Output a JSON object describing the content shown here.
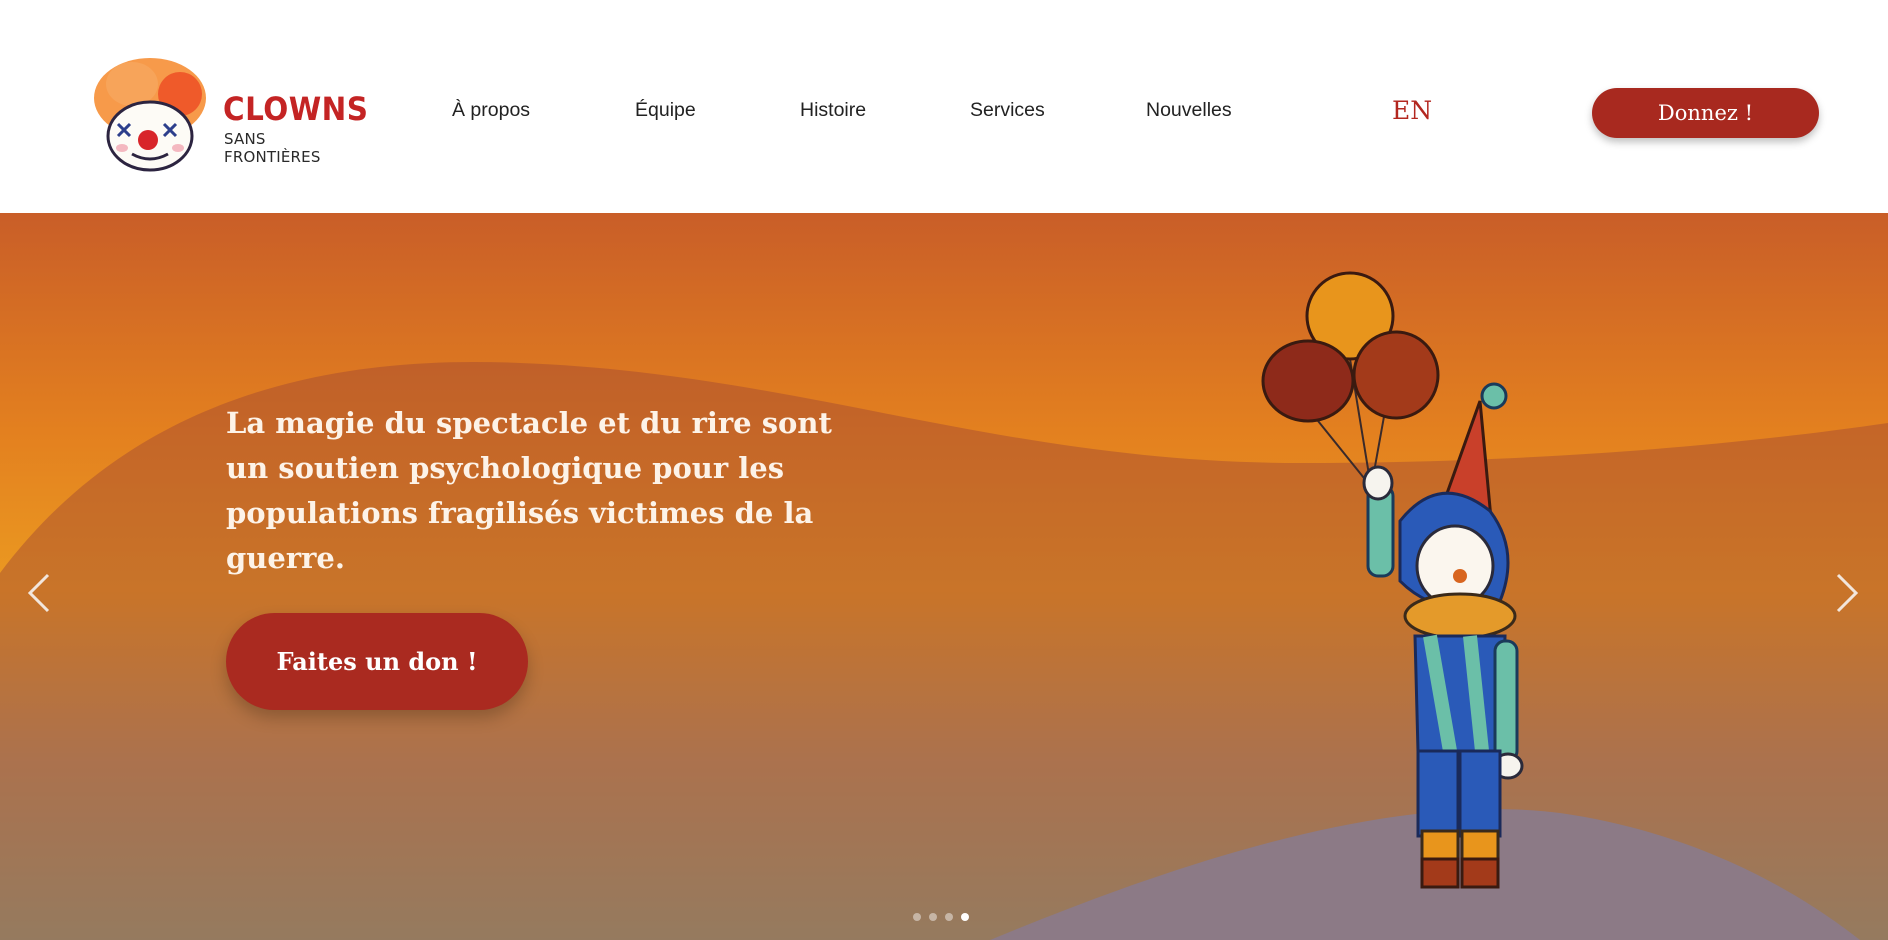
{
  "header": {
    "logo": {
      "title": "CLOWNS",
      "subtitle": "SANS FRONTIÈRES"
    },
    "nav": [
      {
        "label": "À propos"
      },
      {
        "label": "Équipe"
      },
      {
        "label": "Histoire"
      },
      {
        "label": "Services"
      },
      {
        "label": "Nouvelles"
      }
    ],
    "lang_label": "EN",
    "donate_label": "Donnez !"
  },
  "hero": {
    "headline": "La magie du spectacle et du rire sont un soutien psychologique pour les populations fragilisés victimes de la guerre.",
    "cta_label": "Faites un don !",
    "slides_count": 4,
    "active_slide": 4,
    "illustration": "clown-with-balloons"
  },
  "colors": {
    "brand_red": "#a8291f",
    "logo_red": "#c42424",
    "hero_orange": "#e3801f"
  },
  "icons": {
    "prev": "chevron-left-icon",
    "next": "chevron-right-icon"
  }
}
